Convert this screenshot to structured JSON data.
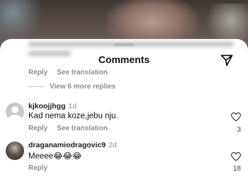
{
  "sheet": {
    "title": "Comments",
    "icons": {
      "share": "paper-plane-icon",
      "like": "heart-outline-icon"
    }
  },
  "top_comment": {
    "actions": [
      "Reply",
      "See translation"
    ],
    "view_more": "View 6 more replies"
  },
  "comments": [
    {
      "username": "kjkoojjhgg",
      "time": "1d",
      "text": "Kad nema koze,jebu nju.",
      "actions": [
        "Reply",
        "See translation"
      ],
      "likes": "3"
    },
    {
      "username": "draganamiodragovic9",
      "time": "2d",
      "text": "Meeee😂😂😂",
      "actions": [
        "Reply"
      ],
      "likes": "18"
    }
  ],
  "colors": {
    "secondary_text": "#8e8e8e",
    "primary_text": "#111111",
    "sheet_bg": "#ffffff"
  }
}
